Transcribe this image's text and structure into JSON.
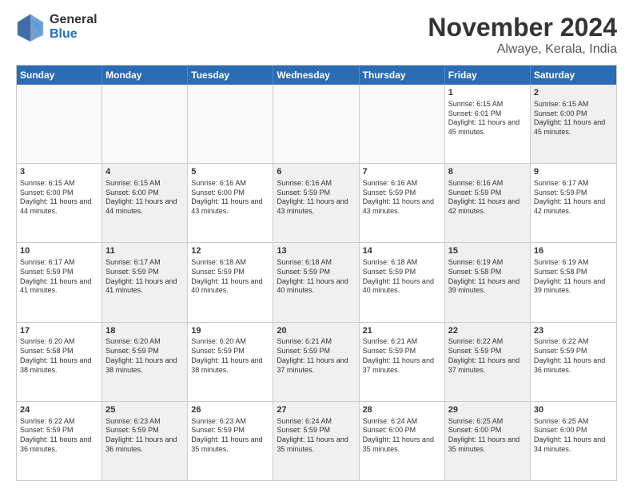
{
  "logo": {
    "general": "General",
    "blue": "Blue"
  },
  "title": {
    "month": "November 2024",
    "location": "Alwaye, Kerala, India"
  },
  "header_days": [
    "Sunday",
    "Monday",
    "Tuesday",
    "Wednesday",
    "Thursday",
    "Friday",
    "Saturday"
  ],
  "rows": [
    [
      {
        "day": "",
        "info": "",
        "shaded": false,
        "empty": true
      },
      {
        "day": "",
        "info": "",
        "shaded": false,
        "empty": true
      },
      {
        "day": "",
        "info": "",
        "shaded": false,
        "empty": true
      },
      {
        "day": "",
        "info": "",
        "shaded": false,
        "empty": true
      },
      {
        "day": "",
        "info": "",
        "shaded": false,
        "empty": true
      },
      {
        "day": "1",
        "info": "Sunrise: 6:15 AM\nSunset: 6:01 PM\nDaylight: 11 hours\nand 45 minutes.",
        "shaded": false,
        "empty": false
      },
      {
        "day": "2",
        "info": "Sunrise: 6:15 AM\nSunset: 6:00 PM\nDaylight: 11 hours\nand 45 minutes.",
        "shaded": true,
        "empty": false
      }
    ],
    [
      {
        "day": "3",
        "info": "Sunrise: 6:15 AM\nSunset: 6:00 PM\nDaylight: 11 hours\nand 44 minutes.",
        "shaded": false,
        "empty": false
      },
      {
        "day": "4",
        "info": "Sunrise: 6:15 AM\nSunset: 6:00 PM\nDaylight: 11 hours\nand 44 minutes.",
        "shaded": true,
        "empty": false
      },
      {
        "day": "5",
        "info": "Sunrise: 6:16 AM\nSunset: 6:00 PM\nDaylight: 11 hours\nand 43 minutes.",
        "shaded": false,
        "empty": false
      },
      {
        "day": "6",
        "info": "Sunrise: 6:16 AM\nSunset: 5:59 PM\nDaylight: 11 hours\nand 43 minutes.",
        "shaded": true,
        "empty": false
      },
      {
        "day": "7",
        "info": "Sunrise: 6:16 AM\nSunset: 5:59 PM\nDaylight: 11 hours\nand 43 minutes.",
        "shaded": false,
        "empty": false
      },
      {
        "day": "8",
        "info": "Sunrise: 6:16 AM\nSunset: 5:59 PM\nDaylight: 11 hours\nand 42 minutes.",
        "shaded": true,
        "empty": false
      },
      {
        "day": "9",
        "info": "Sunrise: 6:17 AM\nSunset: 5:59 PM\nDaylight: 11 hours\nand 42 minutes.",
        "shaded": false,
        "empty": false
      }
    ],
    [
      {
        "day": "10",
        "info": "Sunrise: 6:17 AM\nSunset: 5:59 PM\nDaylight: 11 hours\nand 41 minutes.",
        "shaded": false,
        "empty": false
      },
      {
        "day": "11",
        "info": "Sunrise: 6:17 AM\nSunset: 5:59 PM\nDaylight: 11 hours\nand 41 minutes.",
        "shaded": true,
        "empty": false
      },
      {
        "day": "12",
        "info": "Sunrise: 6:18 AM\nSunset: 5:59 PM\nDaylight: 11 hours\nand 40 minutes.",
        "shaded": false,
        "empty": false
      },
      {
        "day": "13",
        "info": "Sunrise: 6:18 AM\nSunset: 5:59 PM\nDaylight: 11 hours\nand 40 minutes.",
        "shaded": true,
        "empty": false
      },
      {
        "day": "14",
        "info": "Sunrise: 6:18 AM\nSunset: 5:59 PM\nDaylight: 11 hours\nand 40 minutes.",
        "shaded": false,
        "empty": false
      },
      {
        "day": "15",
        "info": "Sunrise: 6:19 AM\nSunset: 5:58 PM\nDaylight: 11 hours\nand 39 minutes.",
        "shaded": true,
        "empty": false
      },
      {
        "day": "16",
        "info": "Sunrise: 6:19 AM\nSunset: 5:58 PM\nDaylight: 11 hours\nand 39 minutes.",
        "shaded": false,
        "empty": false
      }
    ],
    [
      {
        "day": "17",
        "info": "Sunrise: 6:20 AM\nSunset: 5:58 PM\nDaylight: 11 hours\nand 38 minutes.",
        "shaded": false,
        "empty": false
      },
      {
        "day": "18",
        "info": "Sunrise: 6:20 AM\nSunset: 5:59 PM\nDaylight: 11 hours\nand 38 minutes.",
        "shaded": true,
        "empty": false
      },
      {
        "day": "19",
        "info": "Sunrise: 6:20 AM\nSunset: 5:59 PM\nDaylight: 11 hours\nand 38 minutes.",
        "shaded": false,
        "empty": false
      },
      {
        "day": "20",
        "info": "Sunrise: 6:21 AM\nSunset: 5:59 PM\nDaylight: 11 hours\nand 37 minutes.",
        "shaded": true,
        "empty": false
      },
      {
        "day": "21",
        "info": "Sunrise: 6:21 AM\nSunset: 5:59 PM\nDaylight: 11 hours\nand 37 minutes.",
        "shaded": false,
        "empty": false
      },
      {
        "day": "22",
        "info": "Sunrise: 6:22 AM\nSunset: 5:59 PM\nDaylight: 11 hours\nand 37 minutes.",
        "shaded": true,
        "empty": false
      },
      {
        "day": "23",
        "info": "Sunrise: 6:22 AM\nSunset: 5:59 PM\nDaylight: 11 hours\nand 36 minutes.",
        "shaded": false,
        "empty": false
      }
    ],
    [
      {
        "day": "24",
        "info": "Sunrise: 6:22 AM\nSunset: 5:59 PM\nDaylight: 11 hours\nand 36 minutes.",
        "shaded": false,
        "empty": false
      },
      {
        "day": "25",
        "info": "Sunrise: 6:23 AM\nSunset: 5:59 PM\nDaylight: 11 hours\nand 36 minutes.",
        "shaded": true,
        "empty": false
      },
      {
        "day": "26",
        "info": "Sunrise: 6:23 AM\nSunset: 5:59 PM\nDaylight: 11 hours\nand 35 minutes.",
        "shaded": false,
        "empty": false
      },
      {
        "day": "27",
        "info": "Sunrise: 6:24 AM\nSunset: 5:59 PM\nDaylight: 11 hours\nand 35 minutes.",
        "shaded": true,
        "empty": false
      },
      {
        "day": "28",
        "info": "Sunrise: 6:24 AM\nSunset: 6:00 PM\nDaylight: 11 hours\nand 35 minutes.",
        "shaded": false,
        "empty": false
      },
      {
        "day": "29",
        "info": "Sunrise: 6:25 AM\nSunset: 6:00 PM\nDaylight: 11 hours\nand 35 minutes.",
        "shaded": true,
        "empty": false
      },
      {
        "day": "30",
        "info": "Sunrise: 6:25 AM\nSunset: 6:00 PM\nDaylight: 11 hours\nand 34 minutes.",
        "shaded": false,
        "empty": false
      }
    ]
  ]
}
